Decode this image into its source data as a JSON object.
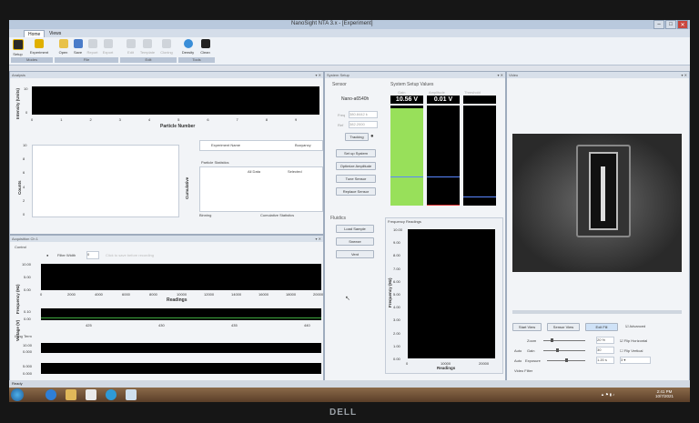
{
  "window": {
    "title": "NanoSight NTA 3.x - [Experiment]",
    "tabs": [
      "Home",
      "Views"
    ]
  },
  "ribbon": {
    "buttons": [
      "Setup",
      "Experiment",
      "Open",
      "Save",
      "Report",
      "Export",
      "Edit",
      "Template",
      "Cloning",
      "Density",
      "Clean"
    ],
    "groups": [
      "Modes",
      "File",
      "Edit",
      "Tools"
    ]
  },
  "analysis": {
    "header": "Analysis",
    "xlabel": "Particle Number",
    "ylabel": "Intensity (Units)",
    "xticks": [
      "0",
      "1",
      "2",
      "3",
      "4",
      "5",
      "6",
      "7",
      "8",
      "9"
    ],
    "yticks": [
      "10",
      "0"
    ],
    "counts_label": "Counts",
    "cumulative_label": "Cumulative",
    "counts_yticks": [
      "10",
      "8",
      "6",
      "4",
      "2",
      "0"
    ],
    "table_headers": [
      "Experiment Name",
      "Buoyancy"
    ],
    "stats_title": "Particle Statistics",
    "stats_cols": [
      "All Data",
      "Selected"
    ],
    "binning": "Binning",
    "cumulative_stats": "Cumulative Statistics"
  },
  "acquisition": {
    "header": "Acquisition Ch 1",
    "control": "Control",
    "filter_width_label": "Filter Width",
    "filter_width_value": "0",
    "filter_hint": "Click to save before recording",
    "freq_ylabel": "Frequency (Hz)",
    "freq_yticks": [
      "10.00",
      "5.00",
      "0.00"
    ],
    "freq_xticks": [
      "0",
      "2000",
      "4000",
      "6000",
      "8000",
      "10000",
      "12000",
      "14000",
      "16000",
      "18000",
      "20000"
    ],
    "freq_xlabel": "Readings",
    "volt_ylabel": "Voltage (V)",
    "volt_yticks": [
      "0.10",
      "0.00"
    ],
    "volt_xticks": [
      "425",
      "430",
      "435",
      "440"
    ],
    "long_term": "Long Term",
    "lt_yticks": [
      "10.00",
      "0.000",
      "5.000",
      "0.000"
    ]
  },
  "system": {
    "header": "System Setup",
    "sensor_title": "Sensor",
    "sensor_name": "Nano-a6540h",
    "freq_label": "Freq",
    "freq_value": "380.8442 k",
    "ref_label": "Ref",
    "ref_value": "382.2000",
    "tracking": "Tracking",
    "buttons": [
      "Set up System",
      "Optimize Amplitude",
      "Tune Sensor",
      "Replace Sensor"
    ],
    "values_title": "System Setup Values",
    "columns": [
      "Gain",
      "Amplitude",
      "Threshold"
    ],
    "gain_value": "10.56 V",
    "amp_value": "0.01 V",
    "gain_fraction": 0.97,
    "fluidics_title": "Fluidics",
    "fluidics_buttons": [
      "Load Sample",
      "Sneeze",
      "Vent"
    ],
    "freq_readings_title": "Frequency Readings",
    "fr_ylabel": "Frequency (Hz)",
    "fr_yticks": [
      "10.00",
      "9.00",
      "8.00",
      "7.00",
      "6.00",
      "5.00",
      "4.00",
      "3.00",
      "2.00",
      "1.00",
      "0.00"
    ],
    "fr_xticks": [
      "0",
      "10000",
      "20000"
    ],
    "fr_xlabel": "Readings"
  },
  "video": {
    "header": "Video",
    "buttons": [
      "Start View",
      "Sensor View",
      "Exit Fill",
      "Advanced"
    ],
    "zoom_label": "Zoom",
    "zoom_value": "20 %",
    "gain_label": "Gain",
    "gain_value": "30",
    "exposure_label": "Exposure",
    "exposure_value": "1.20 s",
    "auto_label": "Auto",
    "flip_h": "Flip Horizontal",
    "flip_v": "Flip Vertical",
    "video_filter": "Video Filter",
    "filter_value": "3"
  },
  "status": {
    "text": "Ready"
  },
  "clock": {
    "time": "2:41 PM",
    "date": "10/7/2021"
  },
  "brand": "DELL",
  "colors": {
    "gain_bar": "#98e05a",
    "amp_line": "#5a86ff",
    "threshold_line": "#5a86ff",
    "accent": "#2a6ebb"
  }
}
